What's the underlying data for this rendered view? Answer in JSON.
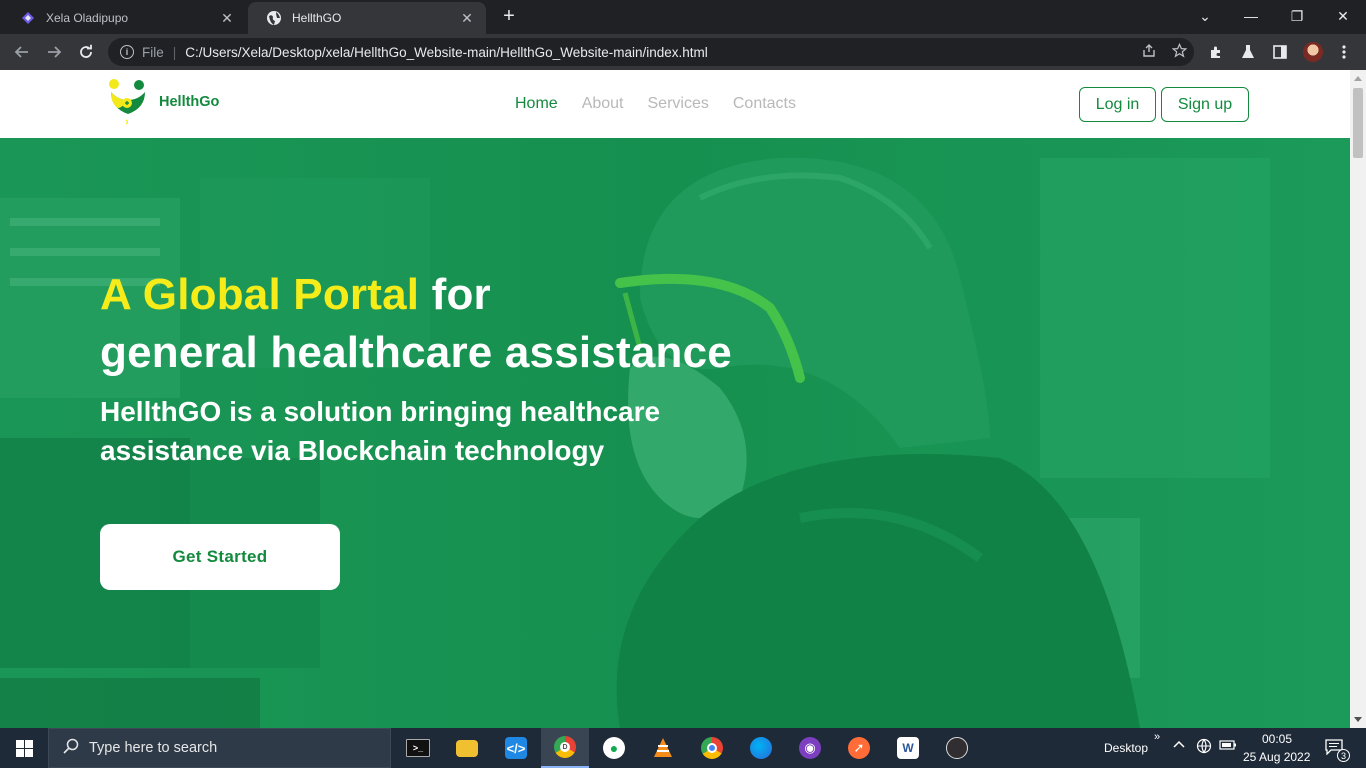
{
  "browser": {
    "tabs": [
      {
        "title": "Xela Oladipupo",
        "close": "✕"
      },
      {
        "title": "HellthGO",
        "close": "✕"
      }
    ],
    "new_tab": "+",
    "window_controls": {
      "dropdown": "⌄",
      "minimize": "—",
      "restore": "❐",
      "close": "✕"
    },
    "address_bar": {
      "scheme": "File",
      "url": "C:/Users/Xela/Desktop/xela/HellthGo_Website-main/HellthGo_Website-main/index.html"
    },
    "icons": [
      "back-icon",
      "forward-icon",
      "reload-icon",
      "info-icon",
      "share-icon",
      "star-icon",
      "extensions-icon",
      "labs-icon",
      "sidepanel-icon",
      "profile-avatar",
      "menu-icon"
    ]
  },
  "site": {
    "brand": "HellthGo",
    "nav": [
      {
        "label": "Home",
        "active": true
      },
      {
        "label": "About",
        "active": false
      },
      {
        "label": "Services",
        "active": false
      },
      {
        "label": "Contacts",
        "active": false
      }
    ],
    "login_label": "Log in",
    "signup_label": "Sign up",
    "hero": {
      "headline_highlight": "A Global Portal",
      "headline_rest": " for",
      "headline_line2": "general healthcare assistance",
      "subline": "HellthGO is a solution bringing healthcare assistance via Blockchain technology",
      "cta_label": "Get Started"
    },
    "colors": {
      "brand_green": "#138a3d",
      "hero_overlay": "#169150",
      "highlight_yellow": "#f5ec1a"
    }
  },
  "taskbar": {
    "search_placeholder": "Type here to search",
    "apps": [
      "terminal-icon",
      "file-explorer-icon",
      "vscode-icon",
      "chrome-dev-icon",
      "mongodb-compass-icon",
      "vlc-icon",
      "chrome-icon",
      "firefox-icon",
      "github-desktop-icon",
      "postman-icon",
      "word-icon",
      "obs-icon"
    ],
    "desktop_label": "Desktop",
    "chevron": "»",
    "time": "00:05",
    "date": "25 Aug 2022",
    "notification_count": "3"
  }
}
